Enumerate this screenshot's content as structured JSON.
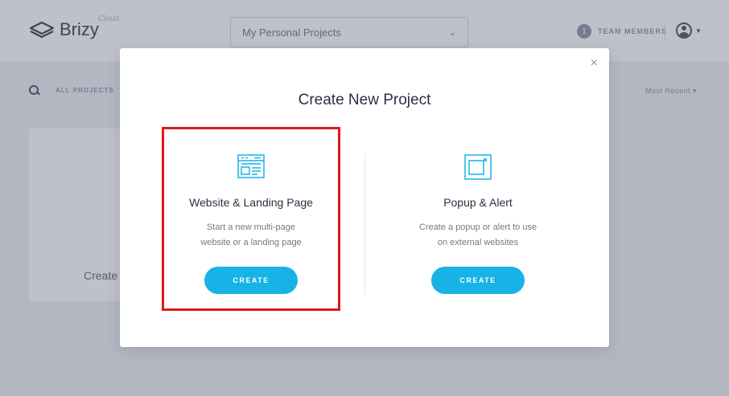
{
  "app": {
    "logo_text": "Brizy",
    "logo_sup": "Cloud"
  },
  "header": {
    "project_select": "My Personal Projects",
    "team_count": "1",
    "team_label": "TEAM MEMBERS"
  },
  "filters": {
    "all_projects": "ALL PROJECTS",
    "sort": "Most Recent"
  },
  "background": {
    "card_label": "Create"
  },
  "modal": {
    "title": "Create New Project",
    "close": "×",
    "options": [
      {
        "title": "Website & Landing Page",
        "desc_line1": "Start a new multi-page",
        "desc_line2": "website or a landing page",
        "button": "CREATE",
        "icon": "website-icon"
      },
      {
        "title": "Popup & Alert",
        "desc_line1": "Create a popup or alert to use",
        "desc_line2": "on external websites",
        "button": "CREATE",
        "icon": "popup-icon"
      }
    ]
  },
  "colors": {
    "accent": "#17b2e6",
    "highlight": "#e01818"
  }
}
